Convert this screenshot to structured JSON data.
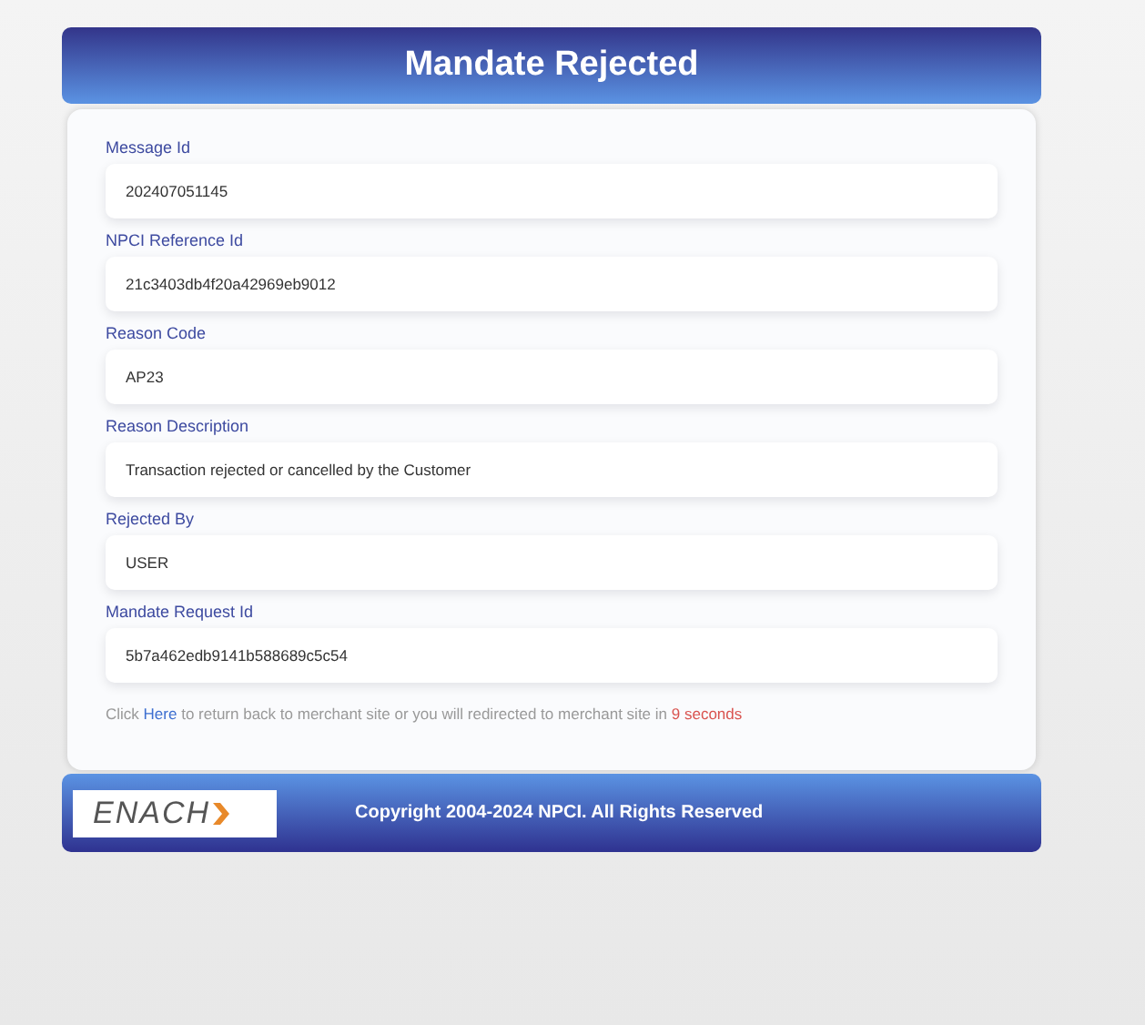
{
  "header": {
    "title": "Mandate Rejected"
  },
  "fields": [
    {
      "label": "Message Id",
      "value": "202407051145"
    },
    {
      "label": "NPCI Reference Id",
      "value": "21c3403db4f20a42969eb9012"
    },
    {
      "label": "Reason Code",
      "value": "AP23"
    },
    {
      "label": "Reason Description",
      "value": "Transaction rejected or cancelled by the Customer"
    },
    {
      "label": "Rejected By",
      "value": "USER"
    },
    {
      "label": "Mandate Request Id",
      "value": "5b7a462edb9141b588689c5c54"
    }
  ],
  "note": {
    "before": "Click ",
    "link": "Here",
    "after": " to return back to merchant site or you will redirected to merchant site in ",
    "countdown": "9 seconds"
  },
  "footer": {
    "logo_text": "ENACH",
    "copyright": "Copyright 2004-2024 NPCI. All Rights Reserved"
  }
}
